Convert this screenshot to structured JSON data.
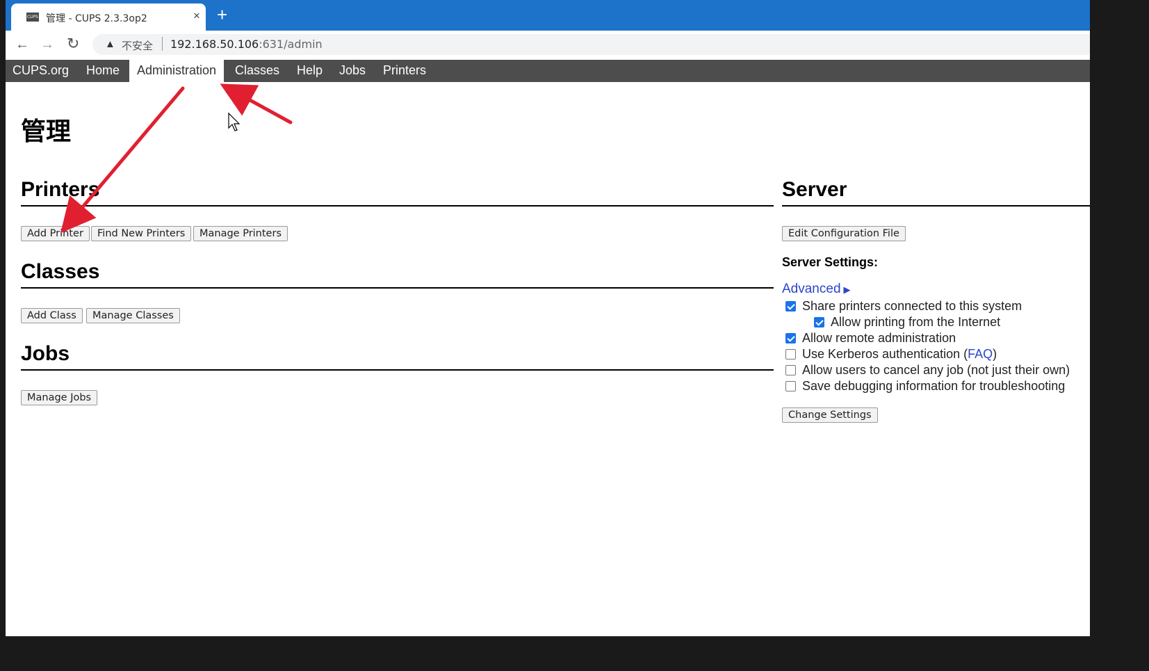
{
  "browser": {
    "tab_title": "管理 - CUPS 2.3.3op2",
    "favicon_text": "CUPS",
    "tab_close": "×",
    "new_tab": "+",
    "back": "←",
    "forward": "→",
    "reload": "↻",
    "security_warning": "不安全",
    "url_host": "192.168.50.106",
    "url_path": ":631/admin"
  },
  "nav": {
    "items": [
      "CUPS.org",
      "Home",
      "Administration",
      "Classes",
      "Help",
      "Jobs",
      "Printers"
    ],
    "active": "Administration"
  },
  "page": {
    "title": "管理"
  },
  "printers": {
    "heading": "Printers",
    "buttons": [
      "Add Printer",
      "Find New Printers",
      "Manage Printers"
    ]
  },
  "classes": {
    "heading": "Classes",
    "buttons": [
      "Add Class",
      "Manage Classes"
    ]
  },
  "jobs": {
    "heading": "Jobs",
    "buttons": [
      "Manage Jobs"
    ]
  },
  "server": {
    "heading": "Server",
    "edit_config_button": "Edit Configuration File",
    "settings_label": "Server Settings:",
    "advanced_link": "Advanced",
    "advanced_arrow": "▶",
    "options": [
      {
        "label": "Share printers connected to this system",
        "checked": true
      },
      {
        "label": "Allow printing from the Internet",
        "checked": true
      },
      {
        "label": "Allow remote administration",
        "checked": true
      },
      {
        "label": "Use Kerberos authentication (",
        "link": "FAQ",
        "suffix": ")",
        "checked": false
      },
      {
        "label": "Allow users to cancel any job (not just their own)",
        "checked": false
      },
      {
        "label": "Save debugging information for troubleshooting",
        "checked": false
      }
    ],
    "change_settings_button": "Change Settings"
  },
  "colors": {
    "tabstrip": "#1c73c9",
    "navbar": "#4d4d4d",
    "link": "#2a45c9",
    "annotation_arrow": "#e02030"
  }
}
